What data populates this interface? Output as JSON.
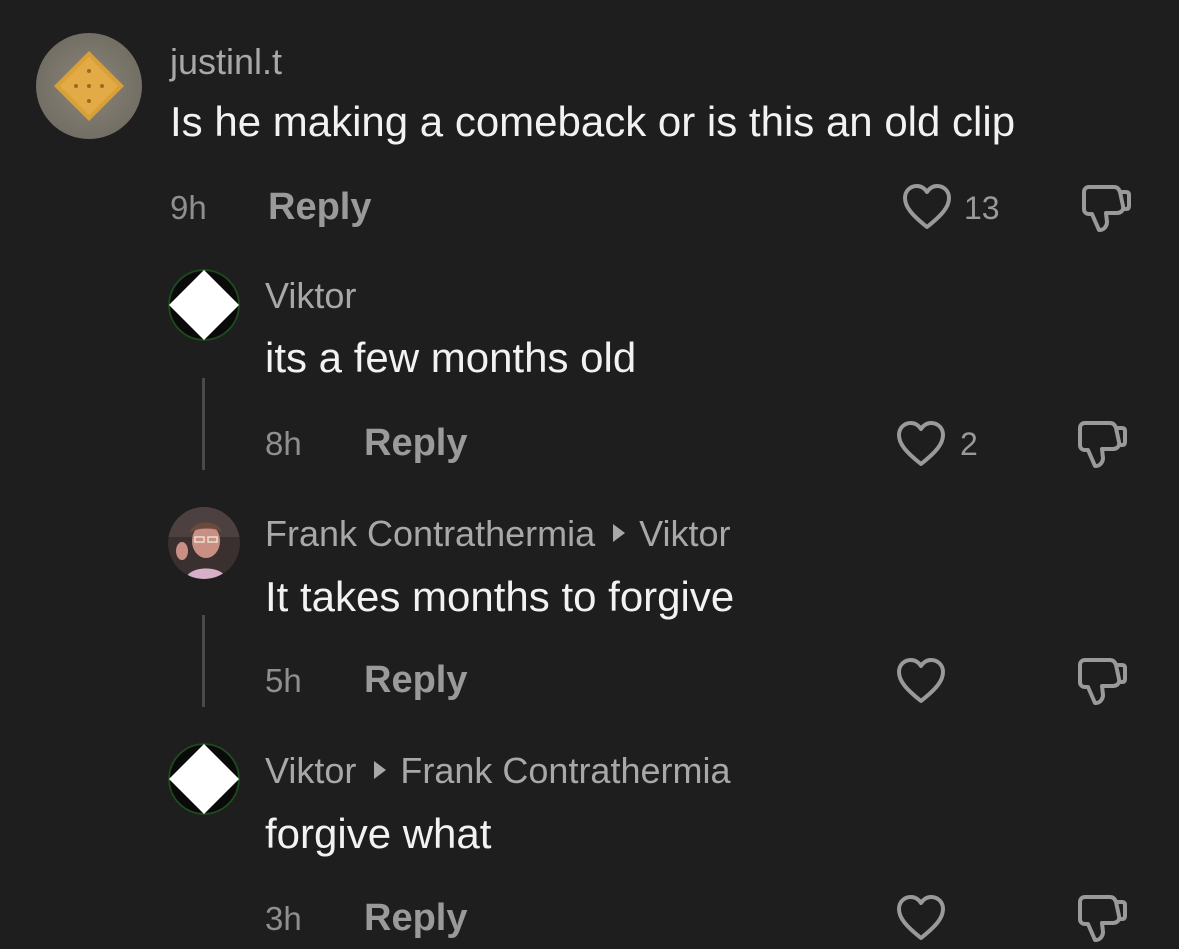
{
  "comments": [
    {
      "username": "justinl.t",
      "text": "Is he making a comeback or is this an old clip",
      "time": "9h",
      "reply_label": "Reply",
      "likes": "13",
      "avatar_icon": "cracker-avatar-icon"
    },
    {
      "username": "Viktor",
      "text": "its a few months old",
      "time": "8h",
      "reply_label": "Reply",
      "likes": "2",
      "avatar_icon": "white-diamond-avatar-icon"
    },
    {
      "username": "Frank Contrathermia",
      "reply_to": "Viktor",
      "text": "It takes months to forgive",
      "time": "5h",
      "reply_label": "Reply",
      "avatar_icon": "person-photo-avatar-icon"
    },
    {
      "username": "Viktor",
      "reply_to": "Frank Contrathermia",
      "text": "forgive what",
      "time": "3h",
      "reply_label": "Reply",
      "avatar_icon": "white-diamond-avatar-icon"
    }
  ],
  "colors": {
    "background": "#1e1e1e",
    "text": "#f2f2f2",
    "muted": "#9a9a9a"
  }
}
